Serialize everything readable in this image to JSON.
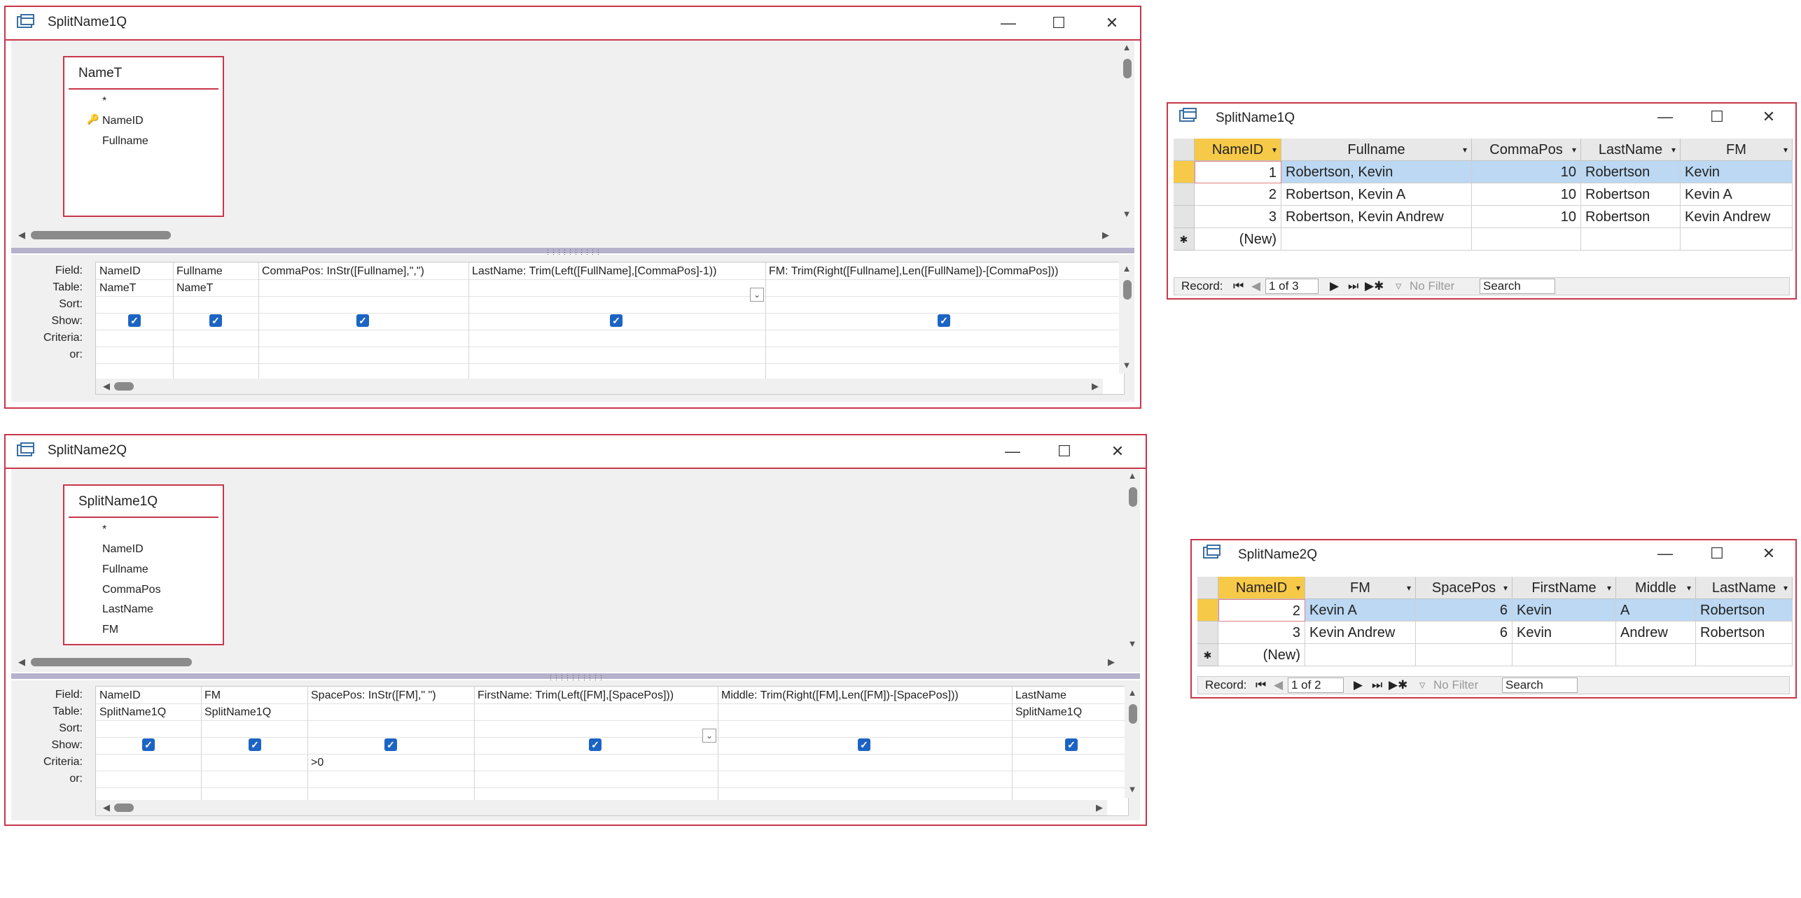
{
  "design_windows": [
    {
      "title": "SplitName1Q",
      "table": {
        "name": "NameT",
        "fields": [
          "*",
          "NameID",
          "Fullname"
        ],
        "key_field_index": 1
      },
      "row_labels": [
        "Field:",
        "Table:",
        "Sort:",
        "Show:",
        "Criteria:",
        "or:"
      ],
      "columns": [
        {
          "field": "NameID",
          "table": "NameT",
          "show": true,
          "criteria": ""
        },
        {
          "field": "Fullname",
          "table": "NameT",
          "show": true,
          "criteria": ""
        },
        {
          "field": "CommaPos: InStr([Fullname],\",\")",
          "table": "",
          "show": true,
          "criteria": ""
        },
        {
          "field": "LastName: Trim(Left([FullName],[CommaPos]-1))",
          "table": "",
          "show": true,
          "criteria": ""
        },
        {
          "field": "FM: Trim(Right([Fullname],Len([FullName])-[CommaPos]))",
          "table": "",
          "show": true,
          "criteria": ""
        }
      ]
    },
    {
      "title": "SplitName2Q",
      "table": {
        "name": "SplitName1Q",
        "fields": [
          "*",
          "NameID",
          "Fullname",
          "CommaPos",
          "LastName",
          "FM"
        ],
        "key_field_index": -1
      },
      "row_labels": [
        "Field:",
        "Table:",
        "Sort:",
        "Show:",
        "Criteria:",
        "or:"
      ],
      "columns": [
        {
          "field": "NameID",
          "table": "SplitName1Q",
          "show": true,
          "criteria": ""
        },
        {
          "field": "FM",
          "table": "SplitName1Q",
          "show": true,
          "criteria": ""
        },
        {
          "field": "SpacePos: InStr([FM],\" \")",
          "table": "",
          "show": true,
          "criteria": ">0"
        },
        {
          "field": "FirstName: Trim(Left([FM],[SpacePos]))",
          "table": "",
          "show": true,
          "criteria": ""
        },
        {
          "field": "Middle: Trim(Right([FM],Len([FM])-[SpacePos]))",
          "table": "",
          "show": true,
          "criteria": ""
        },
        {
          "field": "LastName",
          "table": "SplitName1Q",
          "show": true,
          "criteria": ""
        }
      ]
    }
  ],
  "datasheets": [
    {
      "title": "SplitName1Q",
      "headers": [
        "NameID",
        "Fullname",
        "CommaPos",
        "LastName",
        "FM"
      ],
      "rows": [
        [
          "1",
          "Robertson, Kevin",
          "10",
          "Robertson",
          "Kevin"
        ],
        [
          "2",
          "Robertson, Kevin A",
          "10",
          "Robertson",
          "Kevin A"
        ],
        [
          "3",
          "Robertson, Kevin Andrew",
          "10",
          "Robertson",
          "Kevin Andrew"
        ]
      ],
      "new_row": "(New)",
      "nav": {
        "label": "Record:",
        "position": "1 of 3",
        "filter": "No Filter",
        "search": "Search"
      }
    },
    {
      "title": "SplitName2Q",
      "headers": [
        "NameID",
        "FM",
        "SpacePos",
        "FirstName",
        "Middle",
        "LastName"
      ],
      "rows": [
        [
          "2",
          "Kevin A",
          "6",
          "Kevin",
          "A",
          "Robertson"
        ],
        [
          "3",
          "Kevin Andrew",
          "6",
          "Kevin",
          "Andrew",
          "Robertson"
        ]
      ],
      "new_row": "(New)",
      "nav": {
        "label": "Record:",
        "position": "1 of 2",
        "filter": "No Filter",
        "search": "Search"
      }
    }
  ],
  "colors": {
    "window_border": "#c8374a",
    "selected_header": "#f7c948",
    "row_highlight": "#bcd8f2",
    "checkbox": "#1c64c4"
  }
}
